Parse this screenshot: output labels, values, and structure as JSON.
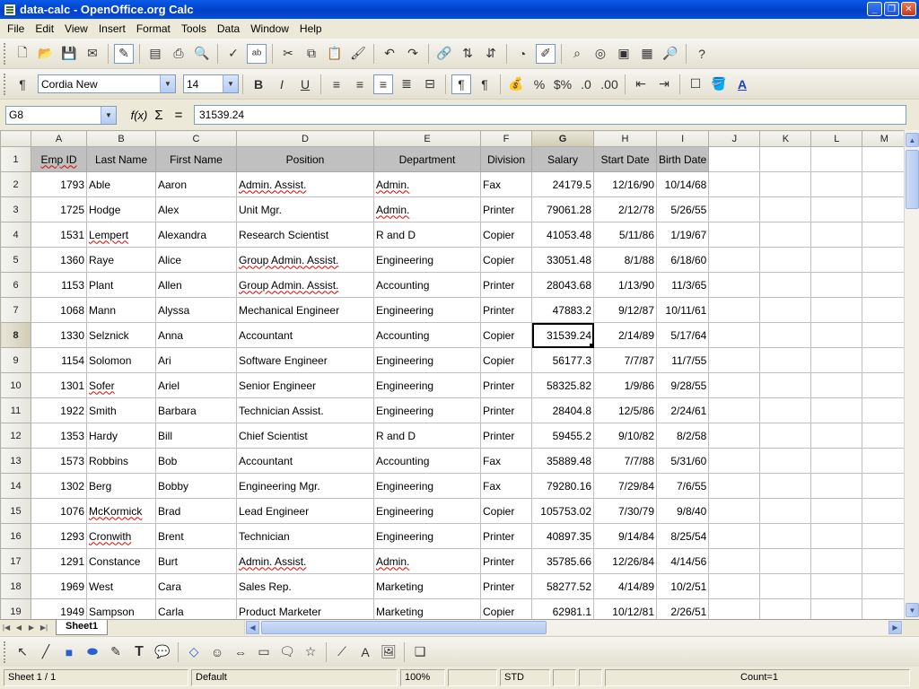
{
  "window": {
    "title": "data-calc - OpenOffice.org Calc"
  },
  "menu": [
    "File",
    "Edit",
    "View",
    "Insert",
    "Format",
    "Tools",
    "Data",
    "Window",
    "Help"
  ],
  "formatting": {
    "font_name": "Cordia New",
    "font_size": "14"
  },
  "formula_bar": {
    "cell_ref": "G8",
    "fx_label": "f(x)",
    "sum_label": "Σ",
    "eq_label": "=",
    "value": "31539.24"
  },
  "columns": [
    "A",
    "B",
    "C",
    "D",
    "E",
    "F",
    "G",
    "H",
    "I",
    "J",
    "K",
    "L",
    "M"
  ],
  "header_row": [
    "Emp ID",
    "Last Name",
    "First Name",
    "Position",
    "Department",
    "Division",
    "Salary",
    "Start Date",
    "Birth Date"
  ],
  "rows": [
    {
      "n": "2",
      "cells": [
        "1793",
        "Able",
        "Aaron",
        "Admin. Assist.",
        "Admin.",
        "Fax",
        "24179.5",
        "12/16/90",
        "10/14/68"
      ]
    },
    {
      "n": "3",
      "cells": [
        "1725",
        "Hodge",
        "Alex",
        "Unit Mgr.",
        "Admin.",
        "Printer",
        "79061.28",
        "2/12/78",
        "5/26/55"
      ]
    },
    {
      "n": "4",
      "cells": [
        "1531",
        "Lempert",
        "Alexandra",
        "Research Scientist",
        "R and D",
        "Copier",
        "41053.48",
        "5/11/86",
        "1/19/67"
      ]
    },
    {
      "n": "5",
      "cells": [
        "1360",
        "Raye",
        "Alice",
        "Group Admin. Assist.",
        "Engineering",
        "Copier",
        "33051.48",
        "8/1/88",
        "6/18/60"
      ]
    },
    {
      "n": "6",
      "cells": [
        "1153",
        "Plant",
        "Allen",
        "Group Admin. Assist.",
        "Accounting",
        "Printer",
        "28043.68",
        "1/13/90",
        "11/3/65"
      ]
    },
    {
      "n": "7",
      "cells": [
        "1068",
        "Mann",
        "Alyssa",
        "Mechanical Engineer",
        "Engineering",
        "Printer",
        "47883.2",
        "9/12/87",
        "10/11/61"
      ]
    },
    {
      "n": "8",
      "cells": [
        "1330",
        "Selznick",
        "Anna",
        "Accountant",
        "Accounting",
        "Copier",
        "31539.24",
        "2/14/89",
        "5/17/64"
      ]
    },
    {
      "n": "9",
      "cells": [
        "1154",
        "Solomon",
        "Ari",
        "Software Engineer",
        "Engineering",
        "Copier",
        "56177.3",
        "7/7/87",
        "11/7/55"
      ]
    },
    {
      "n": "10",
      "cells": [
        "1301",
        "Sofer",
        "Ariel",
        "Senior Engineer",
        "Engineering",
        "Printer",
        "58325.82",
        "1/9/86",
        "9/28/55"
      ]
    },
    {
      "n": "11",
      "cells": [
        "1922",
        "Smith",
        "Barbara",
        "Technician Assist.",
        "Engineering",
        "Printer",
        "28404.8",
        "12/5/86",
        "2/24/61"
      ]
    },
    {
      "n": "12",
      "cells": [
        "1353",
        "Hardy",
        "Bill",
        "Chief Scientist",
        "R and D",
        "Printer",
        "59455.2",
        "9/10/82",
        "8/2/58"
      ]
    },
    {
      "n": "13",
      "cells": [
        "1573",
        "Robbins",
        "Bob",
        "Accountant",
        "Accounting",
        "Fax",
        "35889.48",
        "7/7/88",
        "5/31/60"
      ]
    },
    {
      "n": "14",
      "cells": [
        "1302",
        "Berg",
        "Bobby",
        "Engineering Mgr.",
        "Engineering",
        "Fax",
        "79280.16",
        "7/29/84",
        "7/6/55"
      ]
    },
    {
      "n": "15",
      "cells": [
        "1076",
        "McKormick",
        "Brad",
        "Lead Engineer",
        "Engineering",
        "Copier",
        "105753.02",
        "7/30/79",
        "9/8/40"
      ]
    },
    {
      "n": "16",
      "cells": [
        "1293",
        "Cronwith",
        "Brent",
        "Technician",
        "Engineering",
        "Printer",
        "40897.35",
        "9/14/84",
        "8/25/54"
      ]
    },
    {
      "n": "17",
      "cells": [
        "1291",
        "Constance",
        "Burt",
        "Admin. Assist.",
        "Admin.",
        "Printer",
        "35785.66",
        "12/26/84",
        "4/14/56"
      ]
    },
    {
      "n": "18",
      "cells": [
        "1969",
        "West",
        "Cara",
        "Sales Rep.",
        "Marketing",
        "Printer",
        "58277.52",
        "4/14/89",
        "10/2/51"
      ]
    },
    {
      "n": "19",
      "cells": [
        "1949",
        "Sampson",
        "Carla",
        "Product Marketer",
        "Marketing",
        "Copier",
        "62981.1",
        "10/12/81",
        "2/26/51"
      ]
    }
  ],
  "selected_cell": {
    "column": "G",
    "row": "8"
  },
  "sheet_tab": "Sheet1",
  "status": {
    "sheet": "Sheet 1 / 1",
    "style": "Default",
    "zoom": "100%",
    "mode": "STD",
    "count": "Count=1"
  }
}
